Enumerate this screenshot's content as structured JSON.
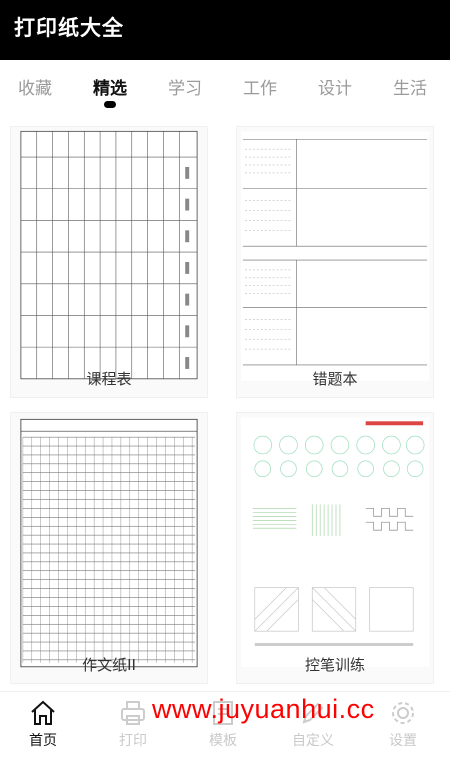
{
  "app": {
    "title": "打印纸大全"
  },
  "tabs": [
    {
      "label": "收藏",
      "active": false
    },
    {
      "label": "精选",
      "active": true
    },
    {
      "label": "学习",
      "active": false
    },
    {
      "label": "工作",
      "active": false
    },
    {
      "label": "设计",
      "active": false
    },
    {
      "label": "生活",
      "active": false
    }
  ],
  "cards": [
    {
      "label": "课程表",
      "thumb": "schedule-table-thumbnail"
    },
    {
      "label": "错题本",
      "thumb": "mistake-notebook-thumbnail"
    },
    {
      "label": "作文纸II",
      "thumb": "composition-grid-thumbnail"
    },
    {
      "label": "控笔训练",
      "thumb": "pen-control-thumbnail"
    }
  ],
  "bottom_nav": [
    {
      "label": "首页",
      "icon": "home-icon",
      "active": true
    },
    {
      "label": "打印",
      "icon": "printer-icon",
      "active": false
    },
    {
      "label": "模板",
      "icon": "template-icon",
      "active": false
    },
    {
      "label": "自定义",
      "icon": "custom-icon",
      "active": false
    },
    {
      "label": "设置",
      "icon": "settings-icon",
      "active": false
    }
  ],
  "watermark": "www.juyuanhui.cc",
  "colors": {
    "topbar": "#000000",
    "active_tab": "#111111",
    "inactive_tab": "#9a9a9a",
    "watermark": "#ff0000"
  }
}
